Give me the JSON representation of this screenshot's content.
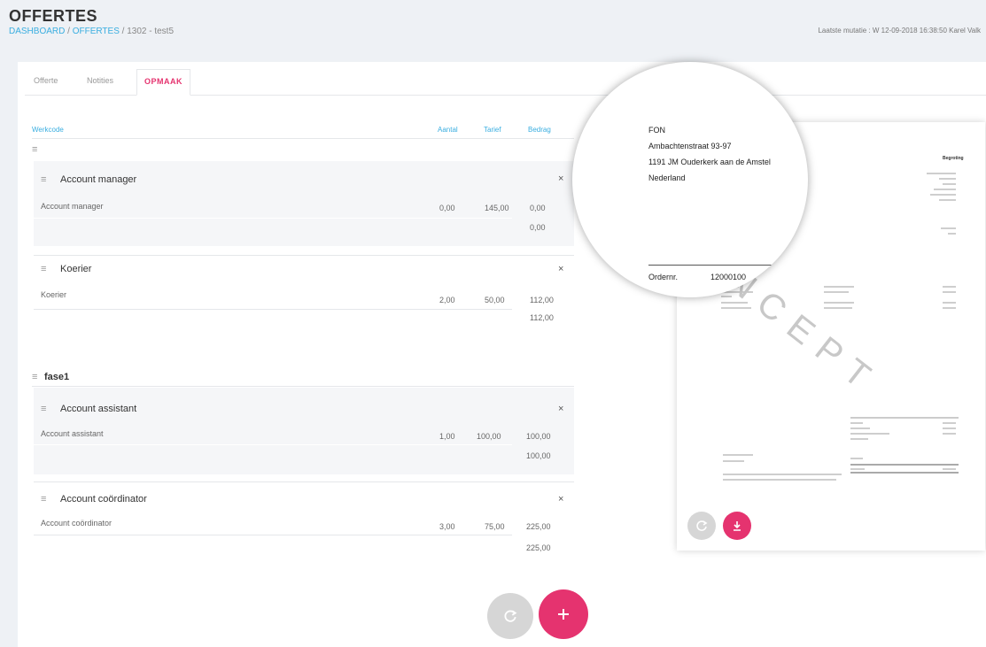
{
  "header": {
    "title": "OFFERTES",
    "breadcrumb": [
      "DASHBOARD",
      "OFFERTES",
      "1302 - test5"
    ],
    "breadcrumb_sep": "/",
    "last_mutation": "Laatste mutatie : W 12-09-2018 16:38:50 Karel Valk"
  },
  "tabs": [
    "Offerte",
    "Notities",
    "OPMAAK"
  ],
  "active_tab": "OPMAAK",
  "columns": {
    "code": "Werkcode",
    "count": "Aantal",
    "rate": "Tarief",
    "amount": "Bedrag"
  },
  "groups": [
    {
      "title": "Account manager",
      "row_label": "Account manager",
      "count": "0,00",
      "rate": "145,00",
      "amount": "0,00",
      "subtotal": "0,00"
    },
    {
      "title": "Koerier",
      "row_label": "Koerier",
      "count": "2,00",
      "rate": "50,00",
      "amount": "112,00",
      "subtotal": "112,00"
    }
  ],
  "section": {
    "title": "fase1"
  },
  "section_groups": [
    {
      "title": "Account assistant",
      "row_label": "Account assistant",
      "count": "1,00",
      "rate": "100,00",
      "amount": "100,00",
      "subtotal": "100,00"
    },
    {
      "title": "Account coördinator",
      "row_label": "Account coördinator",
      "count": "3,00",
      "rate": "75,00",
      "amount": "225,00",
      "subtotal": "225,00"
    }
  ],
  "icons": {
    "drag": "drag-handle-icon",
    "close": "close-icon",
    "refresh": "refresh-icon",
    "add": "plus-icon",
    "download": "download-icon"
  },
  "preview": {
    "address": [
      "FON",
      "Ambachtenstraat 93-97",
      "1191 JM Ouderkerk aan de Amstel",
      "Nederland"
    ],
    "order_label": "Ordernr.",
    "order_value": "12000100",
    "watermark": "CONCEPT",
    "doc_title": "Begroting"
  },
  "colors": {
    "accent": "#e5336f",
    "link": "#3aaee0",
    "grey_button": "#d6d6d6"
  }
}
